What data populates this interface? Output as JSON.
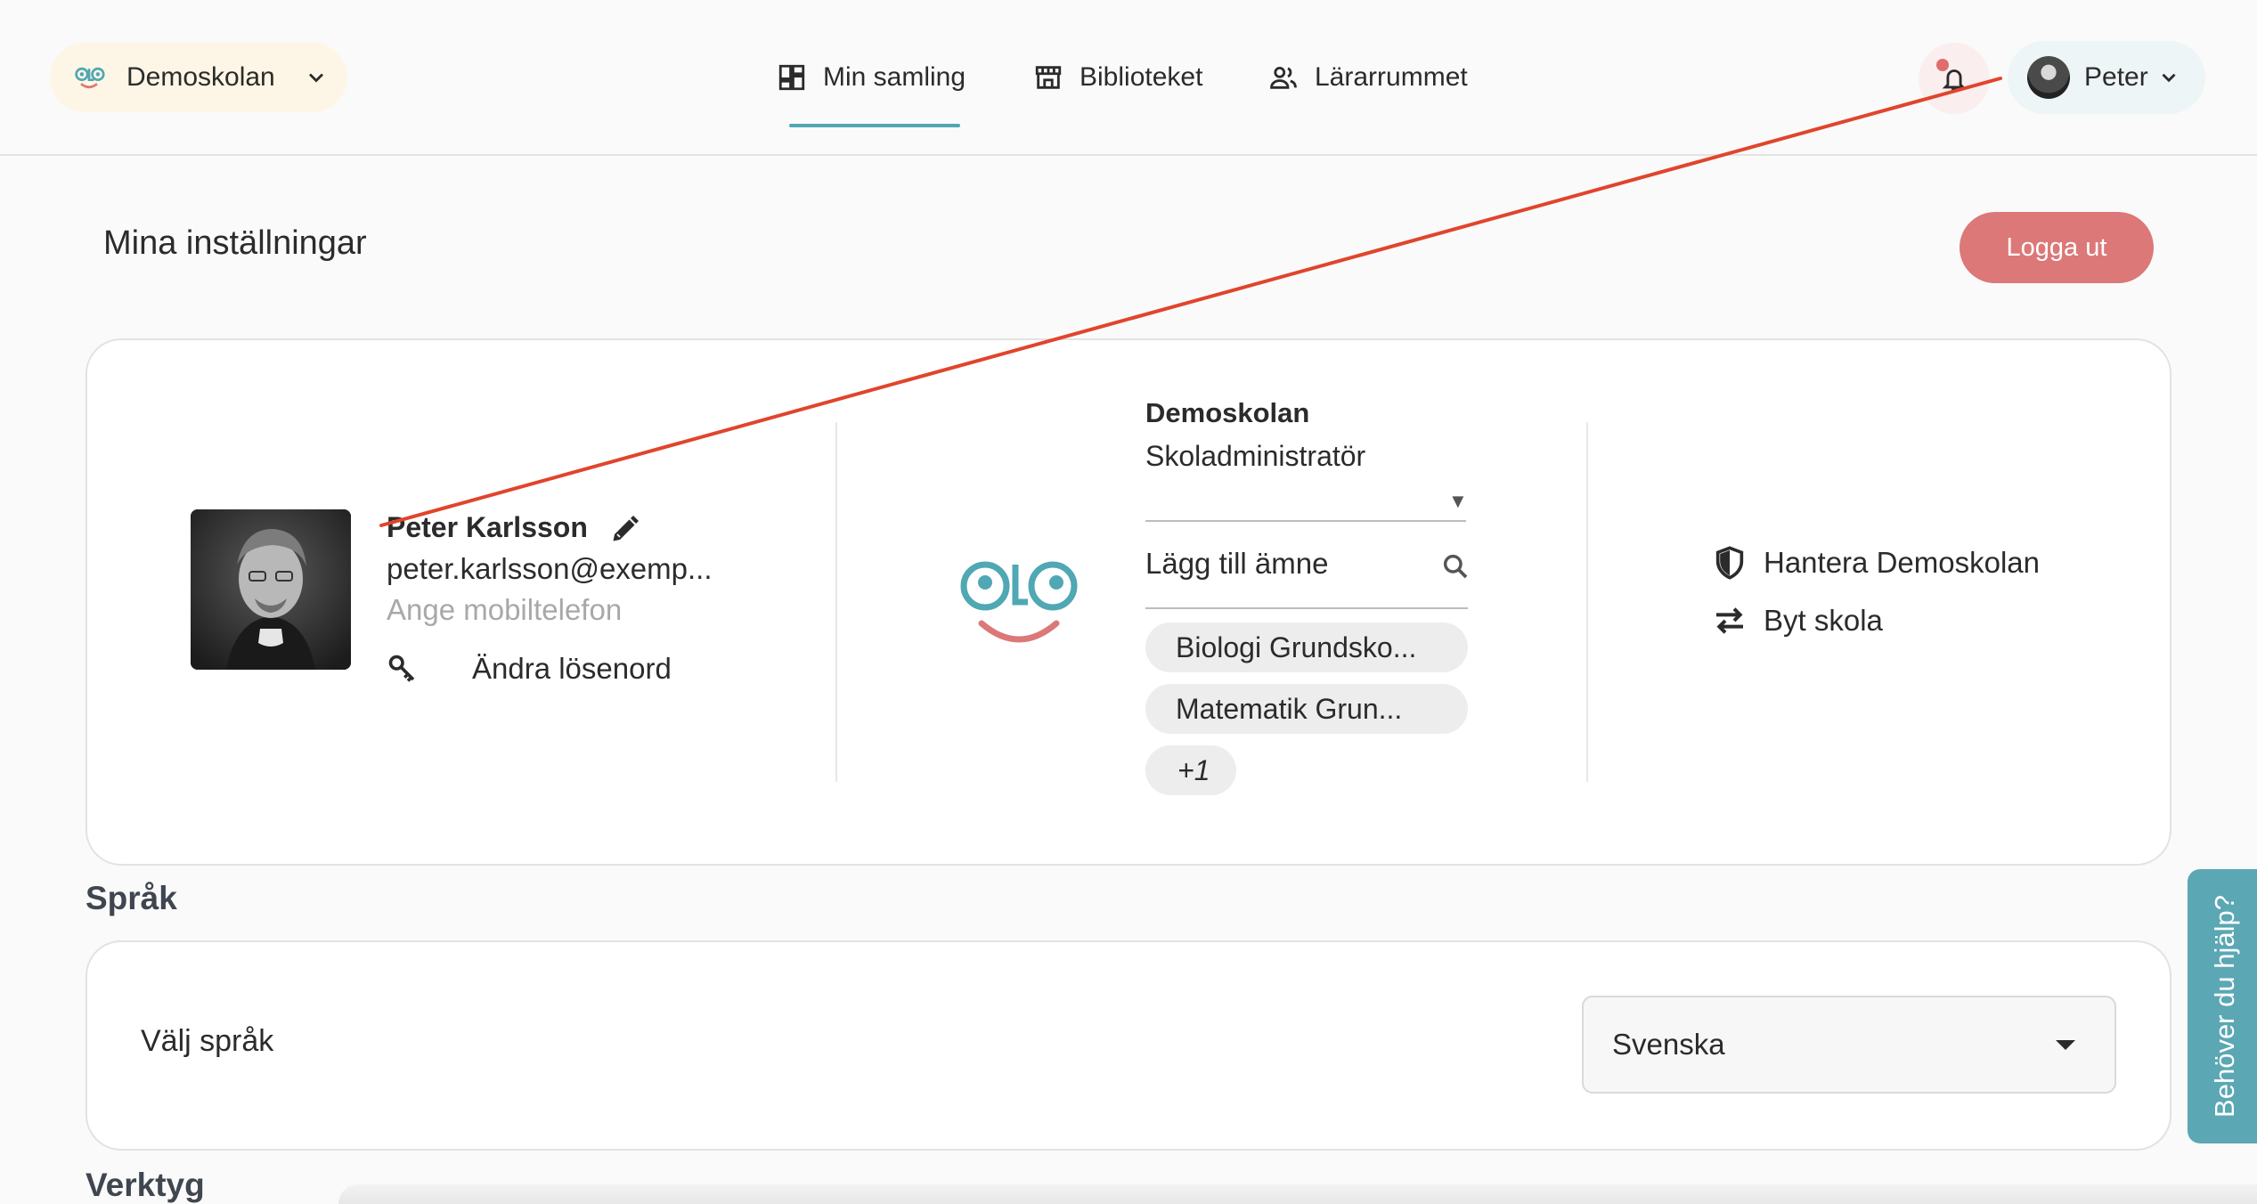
{
  "topbar": {
    "school_switch": {
      "label": "Demoskolan",
      "icon": "olo-logo"
    },
    "nav": [
      {
        "label": "Min samling",
        "icon": "dashboard-icon",
        "active": true
      },
      {
        "label": "Biblioteket",
        "icon": "store-icon"
      },
      {
        "label": "Lärarrummet",
        "icon": "people-icon"
      }
    ],
    "notifications": {
      "icon": "bell-icon",
      "has_unread": true
    },
    "user": {
      "name": "Peter"
    }
  },
  "page": {
    "title": "Mina inställningar",
    "logout_label": "Logga ut"
  },
  "profile": {
    "name": "Peter Karlsson",
    "email": "peter.karlsson@exemp...",
    "phone_placeholder": "Ange mobiltelefon",
    "change_password": "Ändra lösenord"
  },
  "school": {
    "name": "Demoskolan",
    "role": "Skoladministratör",
    "subject_placeholder": "Lägg till ämne",
    "subjects": [
      "Biologi Grundsko...",
      "Matematik Grun...",
      "+1"
    ]
  },
  "admin": {
    "manage": "Hantera Demoskolan",
    "switch": "Byt skola"
  },
  "language": {
    "section_title": "Språk",
    "label": "Välj språk",
    "selected": "Svenska"
  },
  "tools": {
    "section_title": "Verktyg"
  },
  "help": {
    "label": "Behöver du hjälp?"
  },
  "colors": {
    "accent": "#4fa8b3",
    "logout": "#dc7878",
    "school_chip_bg": "#fdf6e6",
    "annotation": "#e0452c"
  }
}
